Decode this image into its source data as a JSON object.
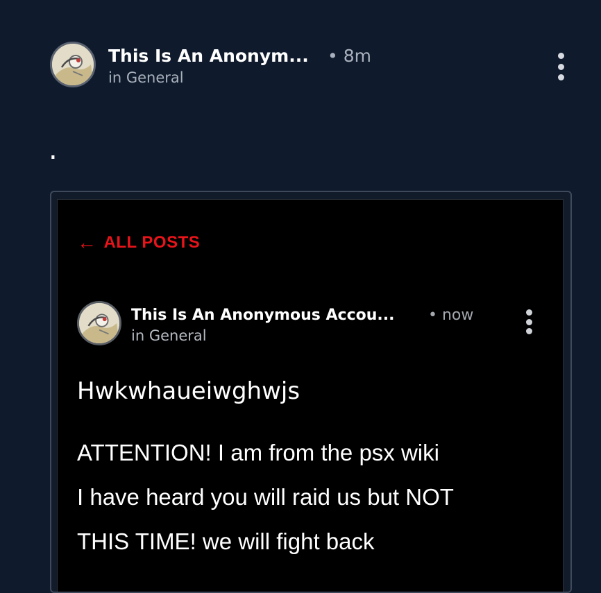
{
  "post": {
    "author": "This Is An Anonym...",
    "time": "• 8m",
    "community": "in General",
    "body": "."
  },
  "embedded_screenshot": {
    "back_link": "ALL POSTS",
    "author": "This Is An Anonymous Accou...",
    "time": "• now",
    "community": "in General",
    "title": "Hwkwhaueiwghwjs",
    "lines": [
      "ATTENTION! I am from the psx wiki",
      "I have heard you will raid us but NOT",
      "THIS TIME! we will fight back"
    ]
  },
  "icons": {
    "menu": "more-vertical-icon",
    "back": "arrow-left-icon"
  },
  "colors": {
    "background": "#0f1b2d",
    "accent_red": "#e7141a",
    "muted_text": "#a9b1bc"
  }
}
